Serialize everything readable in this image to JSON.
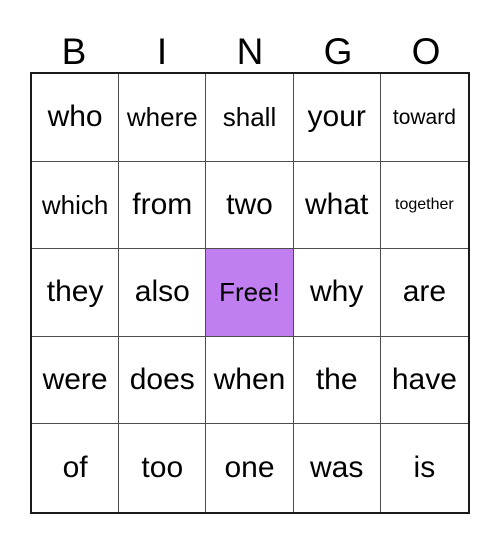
{
  "card": {
    "title": "BINGO",
    "header_letters": [
      "B",
      "I",
      "N",
      "G",
      "O"
    ],
    "free_space_label": "Free!",
    "free_space_color": "#c07ef0",
    "border_color": "#1a1a1a",
    "grid_line_color": "#4d4d4d",
    "text_color": "#000000",
    "background_color": "#ffffff",
    "rows": [
      [
        "who",
        "where",
        "shall",
        "your",
        "toward"
      ],
      [
        "which",
        "from",
        "two",
        "what",
        "together"
      ],
      [
        "they",
        "also",
        "Free!",
        "why",
        "are"
      ],
      [
        "were",
        "does",
        "when",
        "the",
        "have"
      ],
      [
        "of",
        "too",
        "one",
        "was",
        "is"
      ]
    ]
  }
}
